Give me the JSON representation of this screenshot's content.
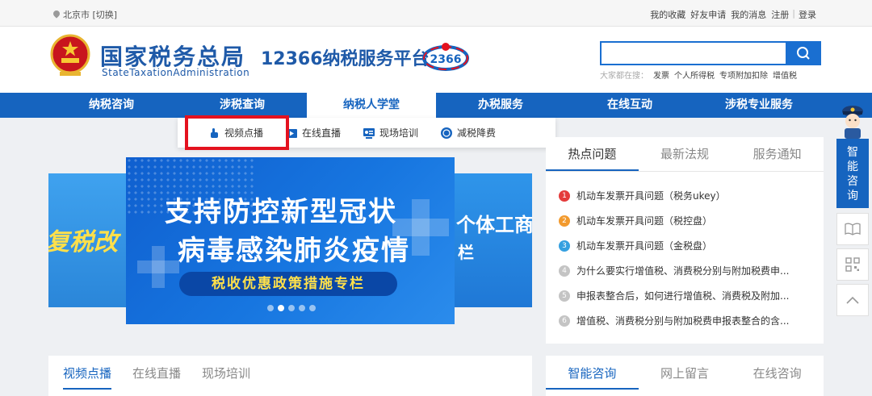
{
  "topbar": {
    "location": "北京市 [切换]",
    "links": [
      "我的收藏",
      "好友申请",
      "我的消息",
      "注册",
      "登录"
    ]
  },
  "header": {
    "brand_cn": "国家税务总局",
    "brand_en": "StateTaxationAdministration",
    "platform": "12366纳税服务平台",
    "search": {
      "value": "",
      "hot_label": "大家都在搜：",
      "hot_terms": [
        "发票",
        "个人所得税",
        "专项附加扣除",
        "增值税"
      ]
    }
  },
  "nav": {
    "items": [
      "纳税咨询",
      "涉税查询",
      "纳税人学堂",
      "办税服务",
      "在线互动",
      "涉税专业服务"
    ],
    "active_index": 2
  },
  "subnav": {
    "items": [
      "视频点播",
      "在线直播",
      "现场培训",
      "减税降费"
    ],
    "highlighted_index": 0
  },
  "carousel": {
    "main_line1": "支持防控新型冠状",
    "main_line2": "病毒感染肺炎疫情",
    "main_pill": "税收优惠政策措施专栏",
    "left_peek": "复税改",
    "right_peek_line1": "个体工商",
    "right_peek_line2": "栏",
    "dot_count": 5,
    "active_dot": 1
  },
  "hot_panel": {
    "tabs": [
      "热点问题",
      "最新法规",
      "服务通知"
    ],
    "active_tab": 0,
    "questions": [
      {
        "num": "1",
        "text": "机动车发票开具问题（税务ukey）"
      },
      {
        "num": "2",
        "text": "机动车发票开具问题（税控盘）"
      },
      {
        "num": "3",
        "text": "机动车发票开具问题（金税盘）"
      },
      {
        "num": "4",
        "text": "为什么要实行增值税、消费税分别与附加税费申..."
      },
      {
        "num": "5",
        "text": "申报表整合后，如何进行增值税、消费税及附加..."
      },
      {
        "num": "6",
        "text": "增值税、消费税分别与附加税费申报表整合的含..."
      }
    ]
  },
  "bottom_left": {
    "tabs": [
      "视频点播",
      "在线直播",
      "现场培训"
    ],
    "active_tab": 0
  },
  "bottom_right": {
    "tabs": [
      "智能咨询",
      "网上留言",
      "在线咨询"
    ],
    "active_tab": 0
  },
  "sidebar": {
    "smart_label": "智能咨询"
  },
  "colors": {
    "brand_blue": "#1664bf",
    "highlight_red": "#e4121f"
  }
}
